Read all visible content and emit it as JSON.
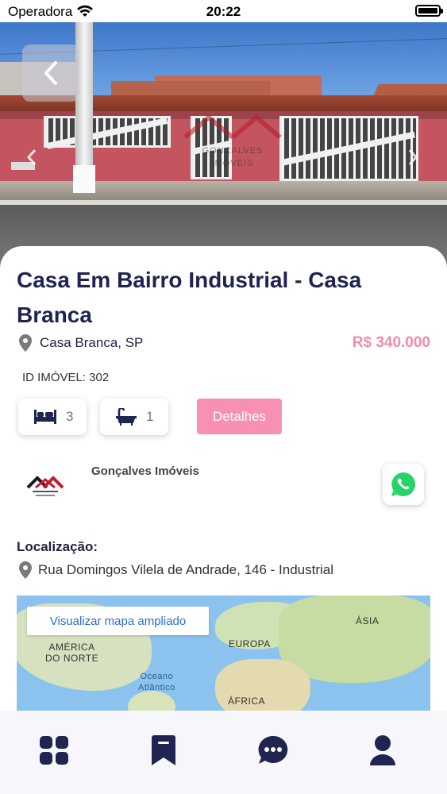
{
  "status_bar": {
    "carrier": "Operadora",
    "time": "20:22"
  },
  "hero": {
    "watermark_line1": "GONÇALVES",
    "watermark_line2": "IMÓVEIS"
  },
  "property": {
    "title": "Casa Em Bairro Industrial - Casa Branca",
    "city": "Casa Branca, SP",
    "price": "R$ 340.000",
    "id_label": "ID IMÓVEL: 302",
    "bedrooms": "3",
    "bathrooms": "1",
    "details_button": "Detalhes"
  },
  "agency": {
    "name": "Gonçalves Imóveis"
  },
  "location": {
    "label": "Localização:",
    "address": "Rua Domingos Vilela de Andrade, 146 - Industrial"
  },
  "map": {
    "expand_button": "Visualizar mapa ampliado",
    "labels": {
      "na_line1": "AMÉRICA",
      "na_line2": "DO NORTE",
      "europe": "EUROPA",
      "asia": "ÁSIA",
      "ocean_line1": "Oceano",
      "ocean_line2": "Atlântico",
      "africa": "ÁFRICA"
    }
  },
  "colors": {
    "accent_pink": "#f890b3",
    "title_navy": "#1f2451",
    "whatsapp_green": "#25d366"
  },
  "bottom_nav": {
    "icons": [
      "grid-icon",
      "bookmark-icon",
      "chat-icon",
      "user-icon"
    ]
  }
}
